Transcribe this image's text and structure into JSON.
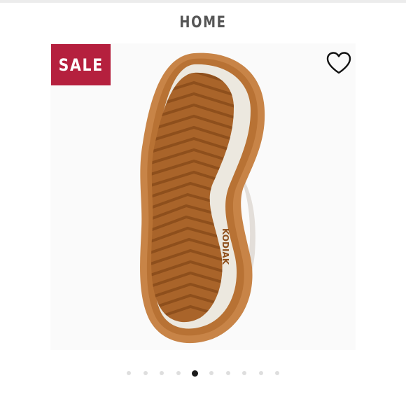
{
  "header": {
    "title": "HOME"
  },
  "product": {
    "badge_label": "SALE",
    "badge_color": "#b5203e",
    "image_icon": "shoe-sole-image",
    "sole_brand_text": "KODIAK",
    "favorite_icon": "heart-outline-icon"
  },
  "carousel": {
    "total_slides": 10,
    "active_index": 4
  }
}
